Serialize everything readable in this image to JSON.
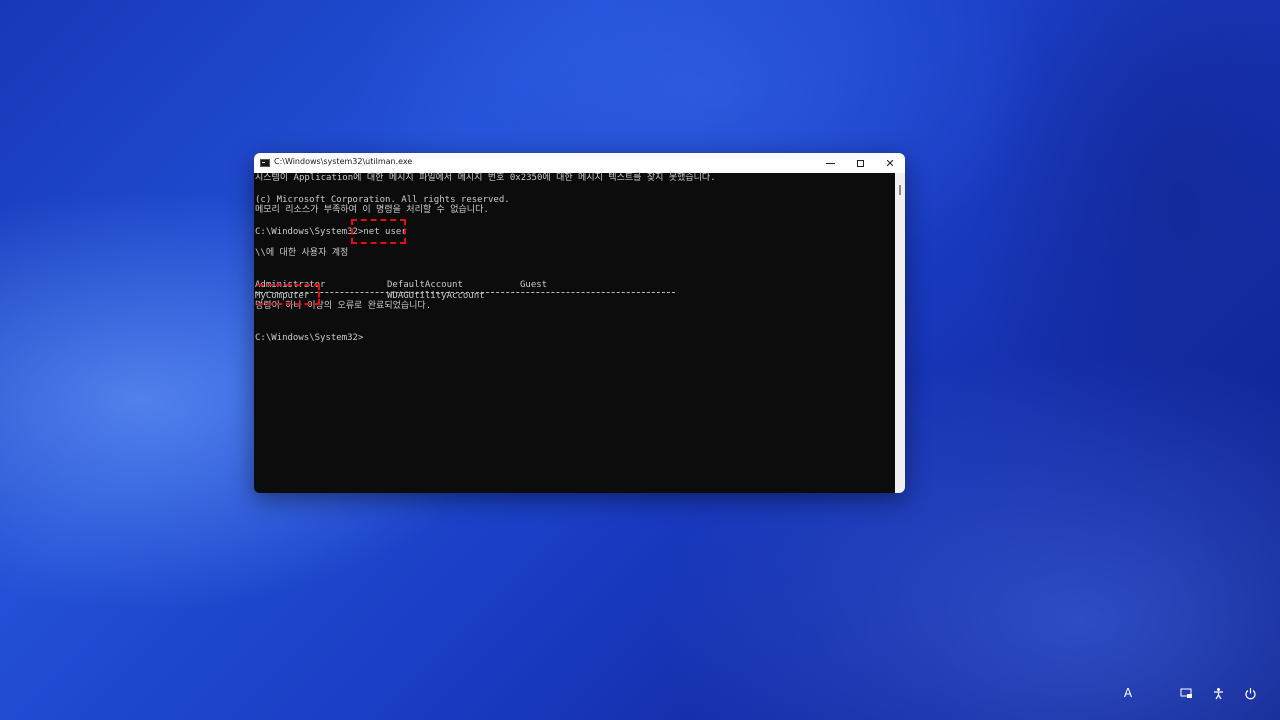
{
  "window": {
    "title": "C:\\Windows\\system32\\utilman.exe",
    "controls": {
      "minimize": "minimize",
      "maximize": "maximize",
      "close": "✕"
    }
  },
  "console": {
    "lines": [
      "시스템이 Application에 대한 메시지 파일에서 메시지 번호 0x2350에 대한 메시지 텍스트를 찾지 못했습니다.",
      "(c) Microsoft Corporation. All rights reserved.",
      "메모리 리소스가 부족하여 이 명령을 처리할 수 없습니다.",
      "C:\\Windows\\System32>net user",
      "\\\\에 대한 사용자 계정",
      "명령이 하나 이상의 오류로 완료되었습니다.",
      "C:\\Windows\\System32>"
    ],
    "accounts": [
      "Administrator",
      "DefaultAccount",
      "Guest",
      "MyComputer",
      "WDAGUtilityAccount"
    ]
  },
  "taskbar": {
    "language": "A",
    "icons": [
      "accessibility-display-icon",
      "accessibility-icon",
      "power-icon"
    ]
  },
  "colors": {
    "console_bg": "#0c0c0c",
    "console_text": "#cccccc",
    "highlight": "#e01010"
  }
}
